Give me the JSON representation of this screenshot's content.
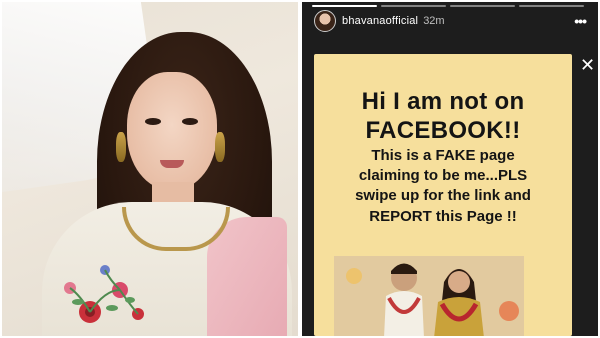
{
  "story": {
    "username": "bhavanaofficial",
    "time": "32m",
    "progress_segments": 4,
    "active_segment": 0,
    "card": {
      "line1": "Hi I am not on",
      "line2": "FACEBOOK!!",
      "line3": "This is a FAKE page",
      "line4": "claiming to be me...PLS",
      "line5": "swipe up for the link and",
      "line6": "REPORT this Page !!"
    }
  },
  "colors": {
    "story_bg": "#1d1d1d",
    "card_bg": "#f6df9c",
    "card_text": "#141414"
  },
  "icons": {
    "more": "more-horizontal-icon",
    "close": "close-icon"
  }
}
